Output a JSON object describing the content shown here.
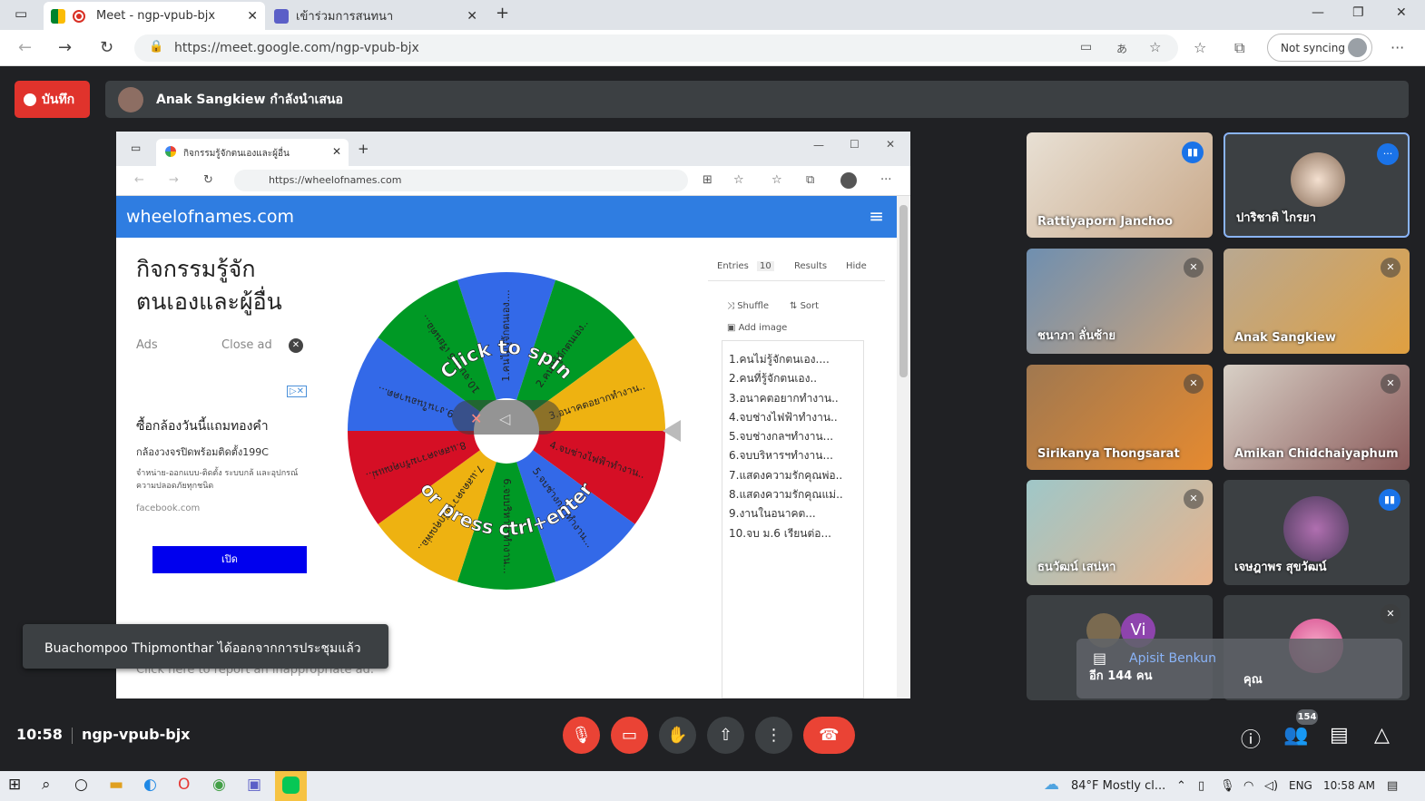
{
  "browser": {
    "tabs": [
      {
        "label": "Meet - ngp-vpub-bjx"
      },
      {
        "label": "เข้าร่วมการสนทนา"
      }
    ],
    "url": "https://meet.google.com/ngp-vpub-bjx",
    "sync_label": "Not syncing"
  },
  "meet": {
    "record_label": "บันทึก",
    "presenter_text": "Anak Sangkiew กำลังนำเสนอ",
    "meeting_code": "ngp-vpub-bjx",
    "time": "10:58",
    "toast": "Buachompoo Thipmonthar ได้ออกจากการประชุมแล้ว",
    "participant_count": "154",
    "others_label": "อีก 144 คน",
    "others_name": "Apisit Benkun",
    "others_initial": "Vi",
    "participants": [
      {
        "name": "Rattiyaporn Janchoo",
        "status": "speaking"
      },
      {
        "name": "ปาริชาติ ไกรยา",
        "status": "more"
      },
      {
        "name": "ชนาภา ลั่นซ้าย",
        "status": "muted"
      },
      {
        "name": "Anak Sangkiew",
        "status": "muted"
      },
      {
        "name": "Sirikanya Thongsarat",
        "status": "muted"
      },
      {
        "name": "Amikan Chidchaiyaphum",
        "status": "muted"
      },
      {
        "name": "ธนวัฒน์ เสน่หา",
        "status": "muted"
      },
      {
        "name": "เจษฎาพร สุขวัฒน์",
        "status": "speaking"
      },
      {
        "name": "คุณ",
        "status": "muted"
      }
    ]
  },
  "shared_screen": {
    "tab_title": "กิจกรรมรู้จักตนเองและผู้อื่น",
    "url": "https://wheelofnames.com",
    "brand": "wheelofnames.com",
    "title": "กิจกรรมรู้จัก ตนเองและผู้อื่น",
    "ads_label": "Ads",
    "close_ad": "Close ad",
    "ad": {
      "line1": "ซื้อกล้องวันนี้แถมทองคำ",
      "line2": "กล้องวงจรปิดพร้อมติดตั้ง199C",
      "line3": "จำหน่าย-ออกแบบ-ติดตั้ง ระบบกล้ และอุปกรณ์ความปลอดภัยทุกชนิด",
      "source": "facebook.com",
      "button": "เปิด"
    },
    "report_ad": "Click here to report an inappropriate ad.",
    "tabs": {
      "entries": "Entries",
      "entries_count": "10",
      "results": "Results",
      "hide": "Hide"
    },
    "shuffle": "Shuffle",
    "sort": "Sort",
    "add_image": "Add image",
    "wheel_text_top": "Click to spin",
    "wheel_text_bottom": "or press ctrl+enter",
    "entries": [
      "1.คนไม่รู้จักตนเอง....",
      "2.คนที่รู้จักตนเอง..",
      "3.อนาคตอยากทำงาน..",
      "4.จบช่างไฟฟ้าทำงาน..",
      "5.จบช่างกลฯทำงาน...",
      "6.จบบริหารฯทำงาน...",
      "7.แสดงความรักคุณพ่อ..",
      "8.แสดงความรักคุณแม่..",
      "9.งานในอนาคต...",
      "10.จบ ม.6 เรียนต่อ..."
    ],
    "segment_colors": [
      "#3369e8",
      "#009925",
      "#eeb211",
      "#d50f25"
    ]
  },
  "taskbar": {
    "weather": "84°F  Mostly cl...",
    "lang": "ENG",
    "clock": "10:58 AM"
  }
}
